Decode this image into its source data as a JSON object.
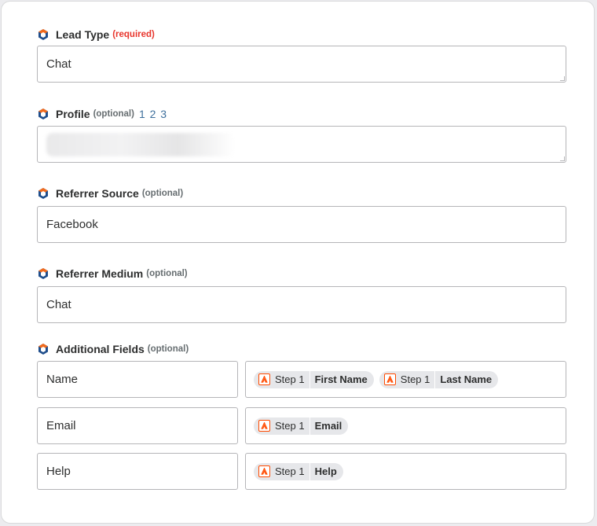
{
  "fields": [
    {
      "label": "Lead Type",
      "tag": "(required)",
      "tag_kind": "required",
      "value": "Chat",
      "icon": "app-logo-icon"
    },
    {
      "label": "Profile",
      "tag": "(optional)",
      "tag_kind": "optional",
      "extra": "1 2 3",
      "value": "",
      "icon": "app-logo-icon"
    },
    {
      "label": "Referrer Source",
      "tag": "(optional)",
      "tag_kind": "optional",
      "value": "Facebook",
      "icon": "app-logo-icon"
    },
    {
      "label": "Referrer Medium",
      "tag": "(optional)",
      "tag_kind": "optional",
      "value": "Chat",
      "icon": "app-logo-icon"
    }
  ],
  "additional": {
    "label": "Additional Fields",
    "tag": "(optional)",
    "rows": [
      {
        "key": "Name",
        "pills": [
          {
            "step": "Step 1",
            "field": "First Name"
          },
          {
            "step": "Step 1",
            "field": "Last Name"
          }
        ]
      },
      {
        "key": "Email",
        "pills": [
          {
            "step": "Step 1",
            "field": "Email"
          }
        ]
      },
      {
        "key": "Help",
        "pills": [
          {
            "step": "Step 1",
            "field": "Help"
          }
        ]
      }
    ]
  },
  "colors": {
    "accent_blue": "#3d6f9c",
    "required_red": "#e8352c",
    "step_orange": "#ff4a00",
    "logo_orange": "#f26b1d",
    "logo_blue": "#1f4e8c"
  }
}
